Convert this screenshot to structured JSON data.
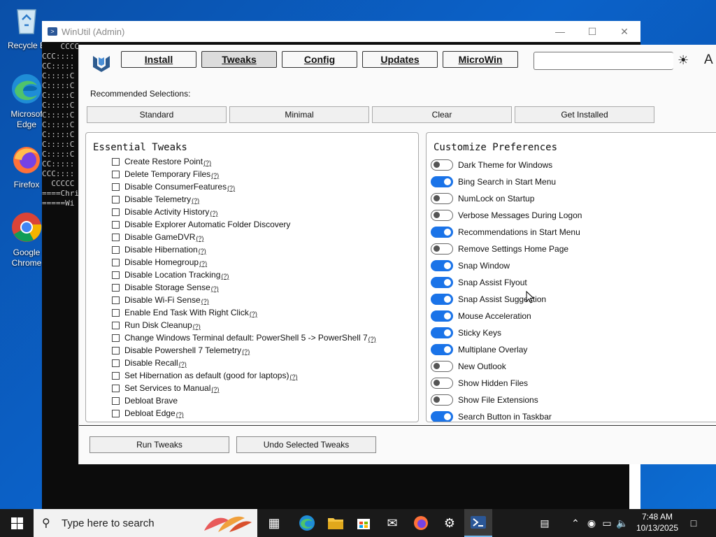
{
  "desktop": {
    "icons": [
      {
        "label": "Recycle B",
        "label2": ""
      },
      {
        "label": "Microsof",
        "label2": "Edge"
      },
      {
        "label": "Firefox",
        "label2": ""
      },
      {
        "label": "Google",
        "label2": "Chrome"
      }
    ]
  },
  "console": {
    "title": "WinUtil (Admin)",
    "lines": [
      "    CCCC",
      "CCC::::",
      "CC:::::",
      "C:::::C",
      "C:::::C",
      "C:::::C",
      "C:::::C",
      "C:::::C",
      "C:::::C",
      "C:::::C",
      "C:::::C",
      "C:::::C",
      "CC:::::",
      "CCC::::",
      "  CCCCC",
      "",
      "====Chri",
      "=====Wi"
    ]
  },
  "app": {
    "nav": [
      "Install",
      "Tweaks",
      "Config",
      "Updates",
      "MicroWin"
    ],
    "active_tab": "Tweaks",
    "search_placeholder": "",
    "theme_icon": "☀",
    "font_icon": "A",
    "recommended_label": "Recommended Selections:",
    "recommended_buttons": [
      "Standard",
      "Minimal",
      "Clear",
      "Get Installed"
    ],
    "essential": {
      "title": "Essential Tweaks",
      "help": "(?)",
      "items": [
        {
          "label": "Create Restore Point",
          "help": true
        },
        {
          "label": "Delete Temporary Files",
          "help": true
        },
        {
          "label": "Disable ConsumerFeatures",
          "help": true
        },
        {
          "label": "Disable Telemetry",
          "help": true
        },
        {
          "label": "Disable Activity History",
          "help": true
        },
        {
          "label": "Disable Explorer Automatic Folder Discovery",
          "help": false
        },
        {
          "label": "Disable GameDVR",
          "help": true
        },
        {
          "label": "Disable Hibernation",
          "help": true
        },
        {
          "label": "Disable Homegroup",
          "help": true
        },
        {
          "label": "Disable Location Tracking",
          "help": true
        },
        {
          "label": "Disable Storage Sense",
          "help": true
        },
        {
          "label": "Disable Wi-Fi Sense",
          "help": true
        },
        {
          "label": "Enable End Task With Right Click",
          "help": true
        },
        {
          "label": "Run Disk Cleanup",
          "help": true
        },
        {
          "label": "Change Windows Terminal default: PowerShell 5 -> PowerShell 7",
          "help": true
        },
        {
          "label": "Disable Powershell 7 Telemetry",
          "help": true
        },
        {
          "label": "Disable Recall",
          "help": true
        },
        {
          "label": "Set Hibernation as default (good for laptops)",
          "help": true
        },
        {
          "label": "Set Services to Manual",
          "help": true
        },
        {
          "label": "Debloat Brave",
          "help": false
        },
        {
          "label": "Debloat Edge",
          "help": true
        }
      ]
    },
    "preferences": {
      "title": "Customize Preferences",
      "items": [
        {
          "label": "Dark Theme for Windows",
          "on": false
        },
        {
          "label": "Bing Search in Start Menu",
          "on": true
        },
        {
          "label": "NumLock on Startup",
          "on": false
        },
        {
          "label": "Verbose Messages During Logon",
          "on": false
        },
        {
          "label": "Recommendations in Start Menu",
          "on": true
        },
        {
          "label": "Remove Settings Home Page",
          "on": false
        },
        {
          "label": "Snap Window",
          "on": true
        },
        {
          "label": "Snap Assist Flyout",
          "on": true
        },
        {
          "label": "Snap Assist Suggestion",
          "on": true
        },
        {
          "label": "Mouse Acceleration",
          "on": true
        },
        {
          "label": "Sticky Keys",
          "on": true
        },
        {
          "label": "Multiplane Overlay",
          "on": true
        },
        {
          "label": "New Outlook",
          "on": false
        },
        {
          "label": "Show Hidden Files",
          "on": false
        },
        {
          "label": "Show File Extensions",
          "on": false
        },
        {
          "label": "Search Button in Taskbar",
          "on": true
        }
      ]
    },
    "bottom_buttons": [
      "Run Tweaks",
      "Undo Selected Tweaks"
    ]
  },
  "taskbar": {
    "search_text": "Type here to search",
    "time": "7:48 AM",
    "date": "10/13/2025"
  }
}
